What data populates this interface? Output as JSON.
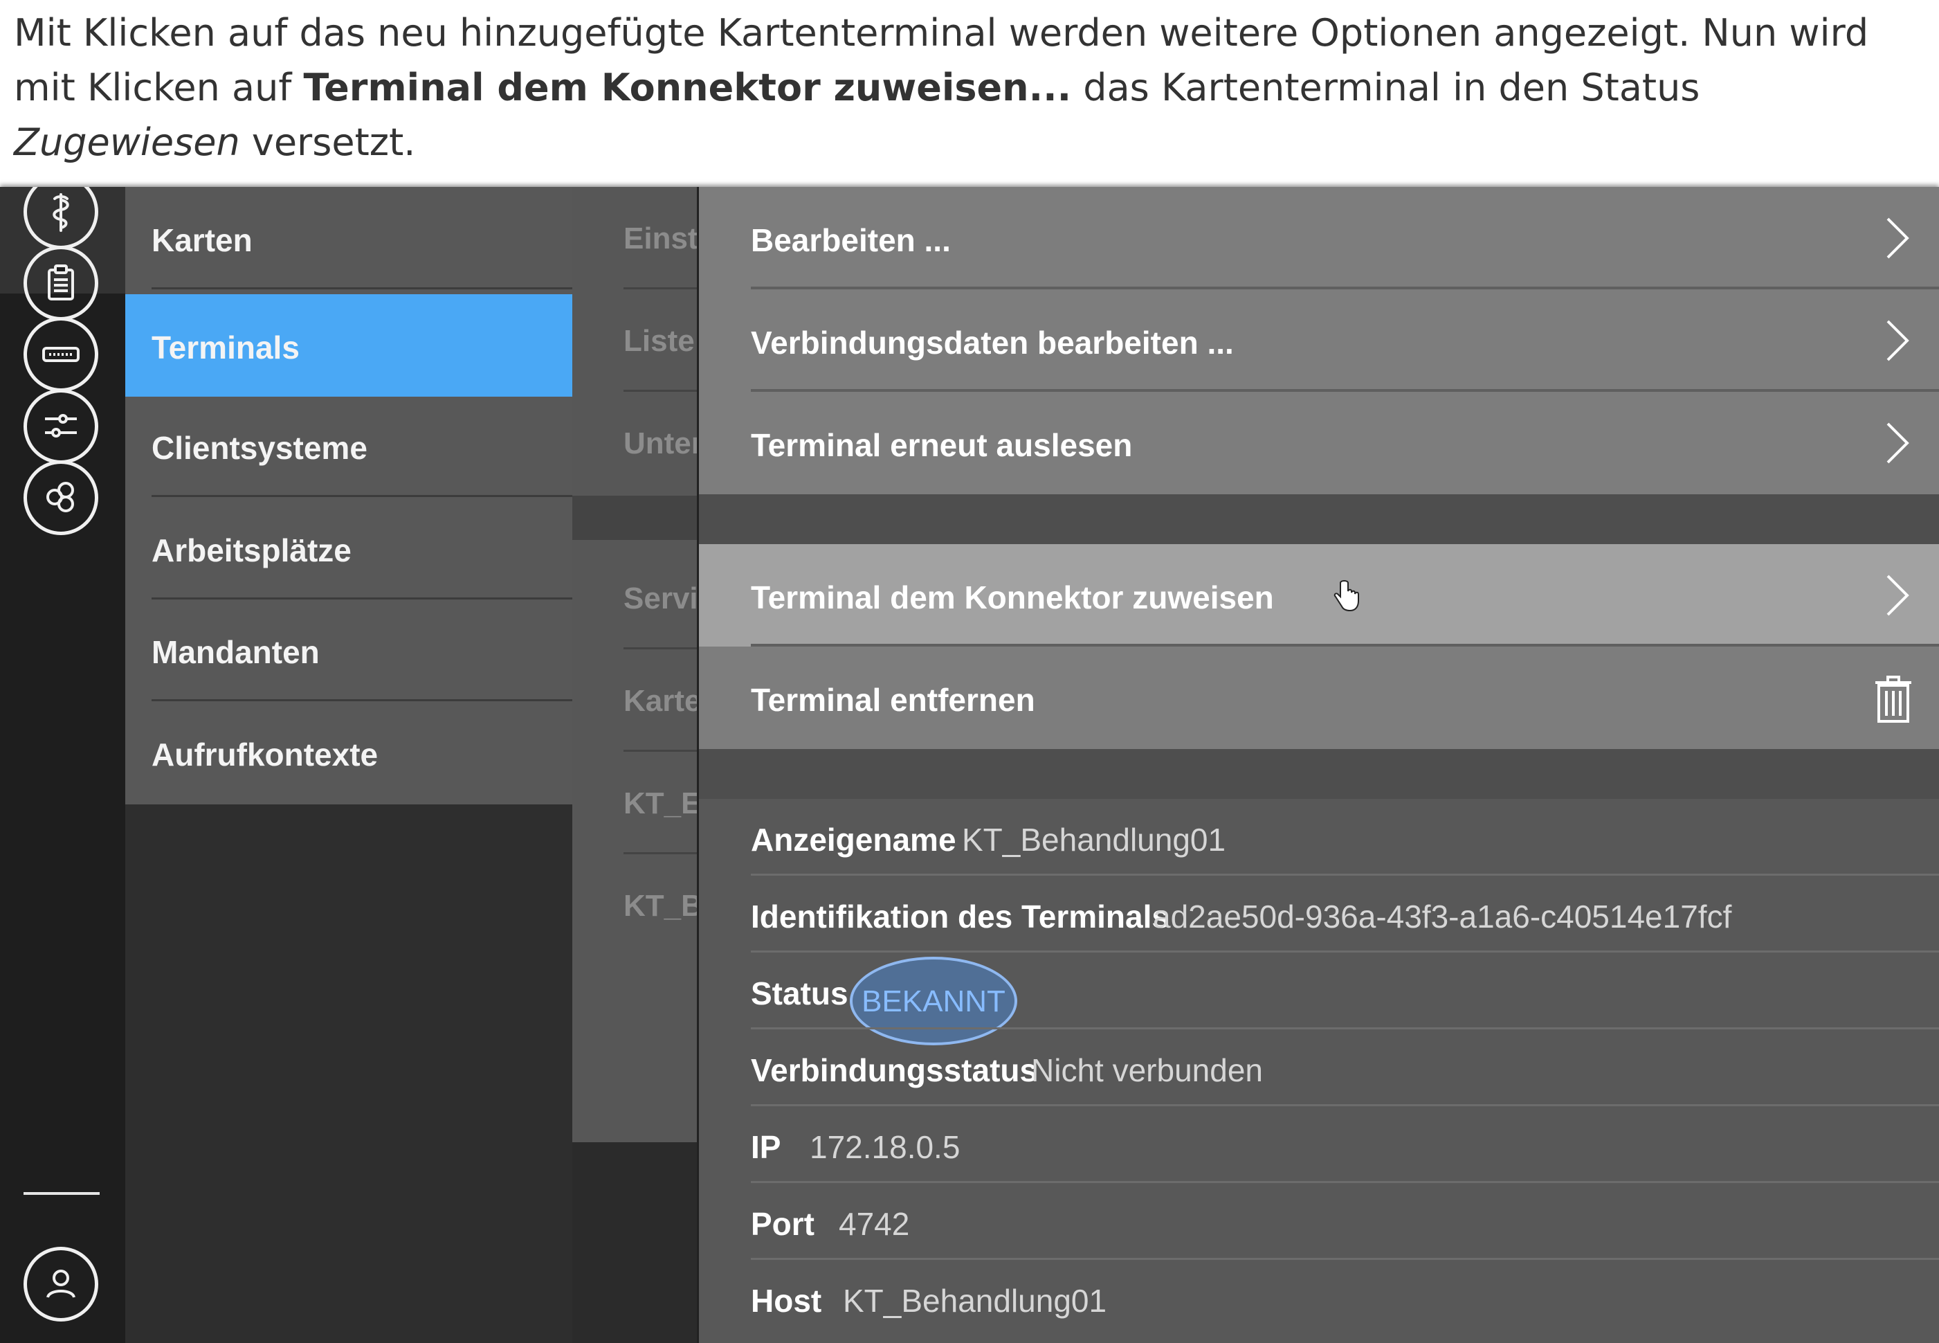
{
  "caption": {
    "part1": "Mit Klicken auf das neu hinzugefügte Kartenterminal werden weitere Optionen angezeigt. Nun wird mit Klicken auf ",
    "bold": "Terminal dem Konnektor zuweisen...",
    "part2": " das Kartenterminal in den Status ",
    "italic": "Zugewiesen",
    "part3": " versetzt."
  },
  "rail": {
    "icons": [
      "caduceus-icon",
      "clipboard-icon",
      "card-reader-icon",
      "sliders-icon",
      "hexagons-icon",
      "user-icon"
    ]
  },
  "nav": {
    "items": [
      {
        "label": "Karten"
      },
      {
        "label": "Terminals",
        "active": true
      },
      {
        "label": "Clientsysteme"
      },
      {
        "label": "Arbeitsplätze"
      },
      {
        "label": "Mandanten"
      },
      {
        "label": "Aufrufkontexte"
      }
    ]
  },
  "subnav": {
    "items": [
      "Einste",
      "Liste d",
      "Unter",
      "Servic",
      "Karter",
      "KT_Er",
      "KT_Be"
    ]
  },
  "menu": {
    "items": [
      {
        "label": "Bearbeiten ...",
        "icon": "chevron-right-icon"
      },
      {
        "label": "Verbindungsdaten bearbeiten ...",
        "icon": "chevron-right-icon"
      },
      {
        "label": "Terminal erneut auslesen",
        "icon": "chevron-right-icon"
      },
      {
        "label": "Terminal dem Konnektor zuweisen",
        "icon": "chevron-right-icon",
        "highlighted": true
      },
      {
        "label": "Terminal entfernen",
        "icon": "trash-icon"
      }
    ]
  },
  "details": {
    "display_name": {
      "key": "Anzeigename",
      "value": "KT_Behandlung01"
    },
    "identification": {
      "key": "Identifikation des Terminals",
      "value": "ad2ae50d-936a-43f3-a1a6-c40514e17fcf"
    },
    "status": {
      "key": "Status",
      "value": "BEKANNT"
    },
    "connection_status": {
      "key": "Verbindungsstatus",
      "value": "Nicht verbunden"
    },
    "ip": {
      "key": "IP",
      "value": "172.18.0.5"
    },
    "port": {
      "key": "Port",
      "value": "4742"
    },
    "host": {
      "key": "Host",
      "value": "KT_Behandlung01"
    }
  },
  "colors": {
    "accent": "#4aa8f5",
    "status_highlight": "#88bcff"
  }
}
